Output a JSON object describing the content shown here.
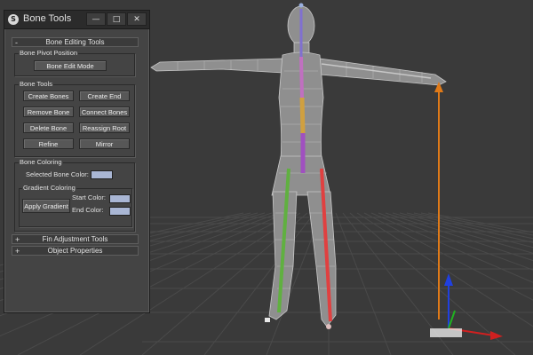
{
  "window": {
    "title": "Bone Tools",
    "icon_name": "app-logo-icon",
    "controls": {
      "minimize": "—",
      "maximize": "□",
      "close": "✕"
    }
  },
  "rollouts": {
    "bone_editing": {
      "sign": "-",
      "label": "Bone Editing Tools"
    },
    "fin_adjustment": {
      "sign": "+",
      "label": "Fin Adjustment Tools"
    },
    "object_properties": {
      "sign": "+",
      "label": "Object Properties"
    }
  },
  "bone_pivot": {
    "label": "Bone Pivot Position",
    "edit_mode": "Bone Edit Mode"
  },
  "bone_tools": {
    "label": "Bone Tools",
    "create_bones": "Create Bones",
    "create_end": "Create End",
    "remove_bone": "Remove Bone",
    "connect_bones": "Connect Bones",
    "delete_bone": "Delete Bone",
    "reassign_root": "Reassign Root",
    "refine": "Refine",
    "mirror": "Mirror"
  },
  "bone_coloring": {
    "label": "Bone Coloring",
    "selected_label": "Selected Bone Color:",
    "selected_color": "#a9b6d4",
    "gradient": {
      "label": "Gradient Coloring",
      "apply": "Apply Gradient",
      "start_label": "Start Color:",
      "start_color": "#a9b6d4",
      "end_label": "End Color:",
      "end_color": "#a9b6d4"
    }
  },
  "viewport": {
    "background": "#3a3a3a",
    "grid_color": "#4a4a4a",
    "mesh_color": "#c9c9c9",
    "height_arrow_color": "#e07a18",
    "gizmo": {
      "x_axis": "#d02020",
      "y_axis": "#20b020",
      "z_axis": "#2040e0"
    },
    "bone_colors": {
      "spine_top": "#8070d0",
      "spine_mid": "#d0a040",
      "spine_low": "#a050c0",
      "left_leg": "#60b040",
      "right_leg": "#e04040"
    }
  }
}
